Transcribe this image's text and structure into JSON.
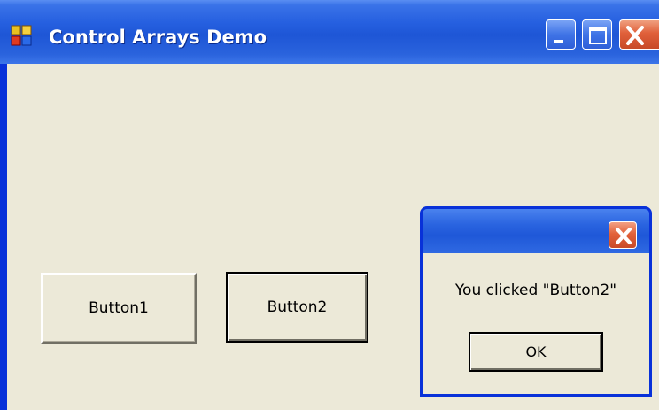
{
  "window": {
    "title": "Control Arrays Demo",
    "icon": "app-window-icon",
    "controls": {
      "minimize": "minimize-icon",
      "maximize": "maximize-icon",
      "close": "close-icon"
    }
  },
  "form": {
    "buttons": [
      {
        "label": "Button1"
      },
      {
        "label": "Button2"
      }
    ]
  },
  "message_box": {
    "message": "You clicked \"Button2\"",
    "ok_label": "OK",
    "close_icon": "close-icon"
  },
  "colors": {
    "titlebar": "#1e56d6",
    "client_background": "#ece9d8",
    "close_button": "#e0603a"
  }
}
